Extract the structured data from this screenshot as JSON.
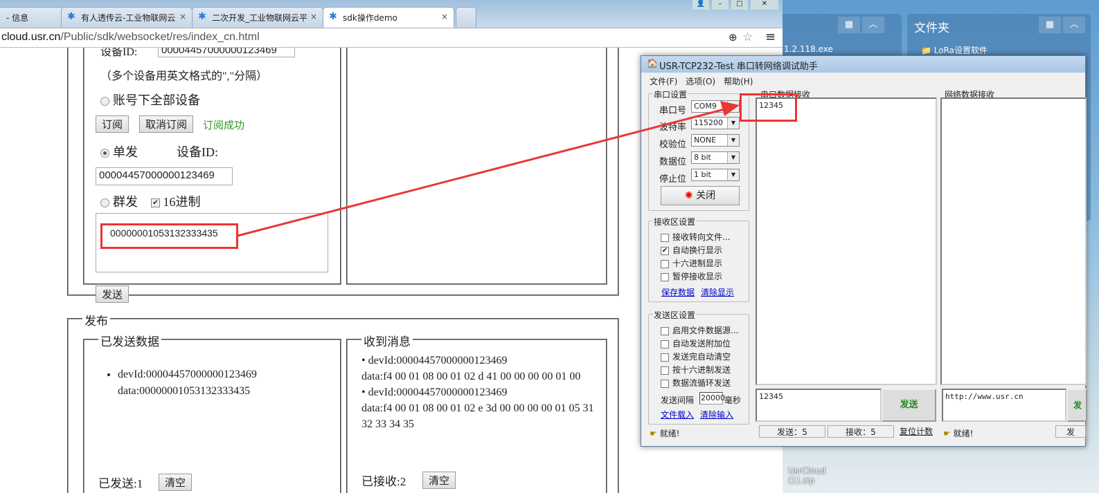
{
  "browser": {
    "tabs": [
      {
        "label": "- 信息"
      },
      {
        "label": "有人透传云-工业物联网云"
      },
      {
        "label": "二次开发_工业物联网云平"
      },
      {
        "label": "sdk操作demo",
        "active": true
      }
    ],
    "url_host": "cloud.usr.cn",
    "url_path": "/Public/sdk/websocket/res/index_cn.html",
    "icons": [
      "zoom-icon",
      "star-icon",
      "menu-icon"
    ]
  },
  "subscribe": {
    "device_id_label": "设备ID:",
    "device_id_value": "00004457000000123469",
    "hint": "（多个设备用英文格式的\",\"分隔）",
    "all_devices_label": "账号下全部设备",
    "subscribe_btn": "订阅",
    "unsubscribe_btn": "取消订阅",
    "status": "订阅成功",
    "status_color": "#2a9a2a"
  },
  "send": {
    "single_label": "单发",
    "single_checked": true,
    "device_id_label": "设备ID:",
    "device_id_value": "00004457000000123469",
    "group_label": "群发",
    "hex_label": "16进制",
    "hex_checked": true,
    "message": "00000001053132333435",
    "send_btn": "发送"
  },
  "publish": {
    "legend": "发布",
    "sent": {
      "legend": "已发送数据",
      "items": [
        {
          "devId": "devId:00004457000000123469",
          "data": "data:00000001053132333435"
        }
      ],
      "count_label": "已发送:",
      "count": "1",
      "clear_btn": "清空"
    },
    "received": {
      "legend": "收到消息",
      "items": [
        {
          "devId": "devId:00004457000000123469",
          "data": "data:f4 00 01 08 00 01 02 d 41 00 00 00 00 01 00"
        },
        {
          "devId": "devId:00004457000000123469",
          "data": "data:f4 00 01 08 00 01 02 e 3d 00 00 00 00 01 05 31 32 33 34 35"
        }
      ],
      "count_label": "已接收:",
      "count": "2",
      "clear_btn": "清空"
    }
  },
  "tool": {
    "title": "USR-TCP232-Test 串口转网络调试助手",
    "menu": [
      "文件(F)",
      "选项(O)",
      "帮助(H)"
    ],
    "serial": {
      "legend": "串口设置",
      "fields": [
        {
          "label": "串口号",
          "value": "COM9"
        },
        {
          "label": "波特率",
          "value": "115200"
        },
        {
          "label": "校验位",
          "value": "NONE"
        },
        {
          "label": "数据位",
          "value": "8 bit"
        },
        {
          "label": "停止位",
          "value": "1 bit"
        }
      ],
      "close_btn": "关闭"
    },
    "recv_settings": {
      "legend": "接收区设置",
      "options": [
        {
          "label": "接收转向文件...",
          "checked": false
        },
        {
          "label": "自动换行显示",
          "checked": true
        },
        {
          "label": "十六进制显示",
          "checked": false
        },
        {
          "label": "暂停接收显示",
          "checked": false
        }
      ],
      "save_link": "保存数据",
      "clear_link": "清除显示"
    },
    "send_settings": {
      "legend": "发送区设置",
      "options": [
        {
          "label": "启用文件数据源...",
          "checked": false
        },
        {
          "label": "自动发送附加位",
          "checked": false
        },
        {
          "label": "发送完自动清空",
          "checked": false
        },
        {
          "label": "按十六进制发送",
          "checked": false
        },
        {
          "label": "数据流循环发送",
          "checked": false
        }
      ],
      "interval_label": "发送间隔",
      "interval_value": "20000",
      "interval_unit": "毫秒",
      "load_link": "文件载入",
      "clear_link": "清除输入"
    },
    "serial_recv": {
      "legend": "串口数据接收",
      "content": "12345"
    },
    "net_recv": {
      "legend": "网络数据接收",
      "content": ""
    },
    "serial_send": {
      "content": "12345",
      "btn": "发送"
    },
    "net_send": {
      "content": "http://www.usr.cn",
      "btn": "发"
    },
    "status": {
      "ready": "就绪!",
      "sent": "发送：5",
      "recv": "接收：5",
      "reset": "复位计数",
      "ready2": "就绪!",
      "sent2": "发"
    }
  },
  "desktop": {
    "panel1_item": "1.2.118.exe",
    "folder_title": "文件夹",
    "folder_item": "LoRa设置软件",
    "file": "UsrCloud",
    "file2": "(1).zip"
  },
  "annotation_color": "#e83838"
}
